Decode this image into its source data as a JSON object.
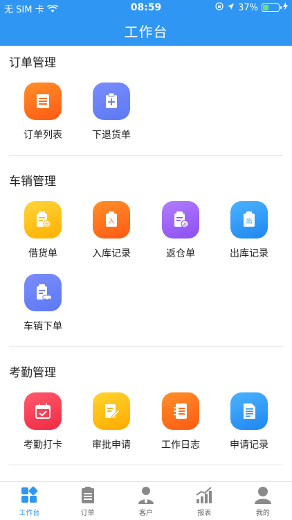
{
  "status": {
    "carrier": "无 SIM 卡",
    "time": "08:59",
    "battery": "37%"
  },
  "header": {
    "title": "工作台"
  },
  "sections": [
    {
      "title": "订单管理",
      "items": [
        {
          "label": "订单列表",
          "icon": "order-list-icon"
        },
        {
          "label": "下退货单",
          "icon": "clipboard-plus-icon"
        }
      ]
    },
    {
      "title": "车销管理",
      "items": [
        {
          "label": "借货单",
          "icon": "borrow-doc-icon"
        },
        {
          "label": "入库记录",
          "icon": "stock-in-icon"
        },
        {
          "label": "返仓单",
          "icon": "return-warehouse-icon"
        },
        {
          "label": "出库记录",
          "icon": "stock-out-icon"
        },
        {
          "label": "车销下单",
          "icon": "car-order-icon"
        }
      ]
    },
    {
      "title": "考勤管理",
      "items": [
        {
          "label": "考勤打卡",
          "icon": "calendar-check-icon"
        },
        {
          "label": "审批申请",
          "icon": "approval-edit-icon"
        },
        {
          "label": "工作日志",
          "icon": "notebook-icon"
        },
        {
          "label": "申请记录",
          "icon": "document-icon"
        }
      ]
    }
  ],
  "tabbar": [
    {
      "label": "工作台",
      "icon": "grid-icon",
      "active": true
    },
    {
      "label": "订单",
      "icon": "clipboard-icon"
    },
    {
      "label": "客户",
      "icon": "person-tie-icon"
    },
    {
      "label": "报表",
      "icon": "chart-icon"
    },
    {
      "label": "我的",
      "icon": "user-icon"
    }
  ],
  "colors": {
    "primary": "#2f96f3"
  }
}
